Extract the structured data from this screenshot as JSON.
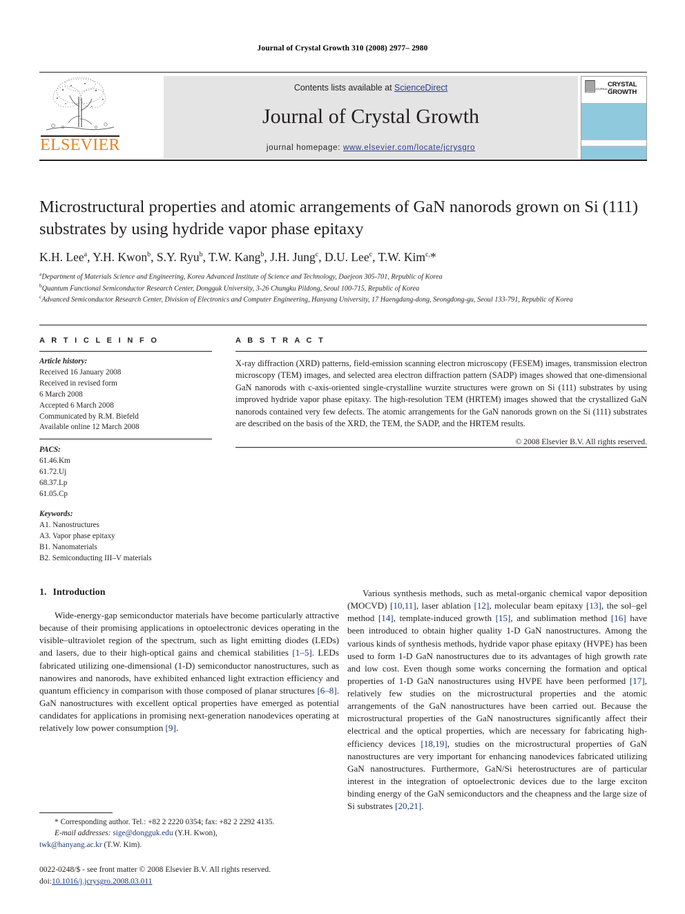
{
  "running_head": "Journal of Crystal Growth 310 (2008) 2977– 2980",
  "masthead": {
    "contents_prefix": "Contents lists available at ",
    "sciencedirect": "ScienceDirect",
    "journal_name": "Journal of Crystal Growth",
    "homepage_prefix": "journal homepage: ",
    "homepage_url": "www.elsevier.com/locate/jcrysgro",
    "publisher": "ELSEVIER",
    "cover": {
      "kicker": "JOURNAL OF",
      "line1": "CRYSTAL",
      "line2": "GROWTH"
    },
    "colors": {
      "elsevier_orange": "#F07F1A",
      "link_blue": "#2b3a8f",
      "contents_bg": "#e4e4e4",
      "cover_band": "#8fc9dd"
    }
  },
  "article": {
    "title": "Microstructural properties and atomic arrangements of GaN nanorods grown on Si (111) substrates by using hydride vapor phase epitaxy",
    "authors_html": "K.H. Lee<sup>a</sup>, Y.H. Kwon<sup>b</sup>, S.Y. Ryu<sup>b</sup>, T.W. Kang<sup>b</sup>, J.H. Jung<sup>c</sup>, D.U. Lee<sup>c</sup>, T.W. Kim<sup>c,</sup>*",
    "affiliations": [
      "a Department of Materials Science and Engineering, Korea Advanced Institute of Science and Technology, Daejeon 305-701, Republic of Korea",
      "b Quantum Functional Semiconductor Research Center, Dongguk University, 3-26 Chungku Pildong, Seoul 100-715, Republic of Korea",
      "c Advanced Semiconductor Research Center, Division of Electronics and Computer Engineering, Hanyang University, 17 Haengdang-dong, Seongdong-gu, Seoul 133-791, Republic of Korea"
    ]
  },
  "article_info": {
    "heading": "A R T I C L E   I N F O",
    "history_label": "Article history:",
    "history": [
      "Received 16 January 2008",
      "Received in revised form",
      "6 March 2008",
      "Accepted 6 March 2008",
      "Communicated by R.M. Biefeld",
      "Available online 12 March 2008"
    ],
    "pacs_label": "PACS:",
    "pacs": [
      "61.46.Km",
      "61.72.Uj",
      "68.37.Lp",
      "61.05.Cp"
    ],
    "keywords_label": "Keywords:",
    "keywords": [
      "A1. Nanostructures",
      "A3. Vapor phase epitaxy",
      "B1. Nanomaterials",
      "B2. Semiconducting III–V materials"
    ]
  },
  "abstract": {
    "heading": "A B S T R A C T",
    "text": "X-ray diffraction (XRD) patterns, field-emission scanning electron microscopy (FESEM) images, transmission electron microscopy (TEM) images, and selected area electron diffraction pattern (SADP) images showed that one-dimensional GaN nanorods with c-axis-oriented single-crystalline wurzite structures were grown on Si (111) substrates by using improved hydride vapor phase epitaxy. The high-resolution TEM (HRTEM) images showed that the crystallized GaN nanorods contained very few defects. The atomic arrangements for the GaN nanorods grown on the Si (111) substrates are described on the basis of the XRD, the TEM, the SADP, and the HRTEM results.",
    "copyright": "© 2008 Elsevier B.V. All rights reserved."
  },
  "body": {
    "section_number": "1.",
    "section_title": "Introduction",
    "left_paragraph_html": "Wide-energy-gap semiconductor materials have become particularly attractive because of their promising applications in optoelectronic devices operating in the visible–ultraviolet region of the spectrum, such as light emitting diodes (LEDs) and lasers, due to their high-optical gains and chemical stabilities <span class=\"ref\">[1–5]</span>. LEDs fabricated utilizing one-dimensional (1-D) semiconductor nanostructures, such as nanowires and nanorods, have exhibited enhanced light extraction efficiency and quantum efficiency in comparison with those composed of planar structures <span class=\"ref\">[6–8]</span>. GaN nanostructures with excellent optical properties have emerged as potential candidates for applications in promising next-generation nanodevices operating at relatively low power consumption <span class=\"ref\">[9]</span>.",
    "right_paragraph_html": "Various synthesis methods, such as metal-organic chemical vapor deposition (MOCVD) <span class=\"ref\">[10,11]</span>, laser ablation <span class=\"ref\">[12]</span>, molecular beam epitaxy <span class=\"ref\">[13]</span>, the sol–gel method <span class=\"ref\">[14]</span>, template-induced growth <span class=\"ref\">[15]</span>, and sublimation method <span class=\"ref\">[16]</span> have been introduced to obtain higher quality 1-D GaN nanostructures. Among the various kinds of synthesis methods, hydride vapor phase epitaxy (HVPE) has been used to form 1-D GaN nanostructures due to its advantages of high growth rate and low cost. Even though some works concerning the formation and optical properties of 1-D GaN nanostructures using HVPE have been performed <span class=\"ref\">[17]</span>, relatively few studies on the microstructural properties and the atomic arrangements of the GaN nanostructures have been carried out. Because the microstructural properties of the GaN nanostructures significantly affect their electrical and the optical properties, which are necessary for fabricating high-efficiency devices <span class=\"ref\">[18,19]</span>, studies on the microstructural properties of GaN nanostructures are very important for enhancing nanodevices fabricated utilizing GaN nanostructures. Furthermore, GaN/Si heterostructures are of particular interest in the integration of optoelectronic devices due to the large exciton binding energy of the GaN semiconductors and the cheapness and the large size of Si substrates <span class=\"ref\">[20,21]</span>."
  },
  "footnotes": {
    "corresponding_html": "* Corresponding author. Tel.: +82 2 2220 0354; fax: +82 2 2292 4135.",
    "email_html": "<span class=\"em-lbl\">E-mail addresses:</span> <span class=\"mail\">sige@dongguk.edu</span> (Y.H. Kwon),",
    "email_html2": "<span class=\"mail\">twk@hanyang.ac.kr</span> (T.W. Kim)."
  },
  "imprint": {
    "line1": "0022-0248/$ - see front matter © 2008 Elsevier B.V. All rights reserved.",
    "doi_prefix": "doi:",
    "doi": "10.1016/j.jcrysgro.2008.03.011"
  }
}
